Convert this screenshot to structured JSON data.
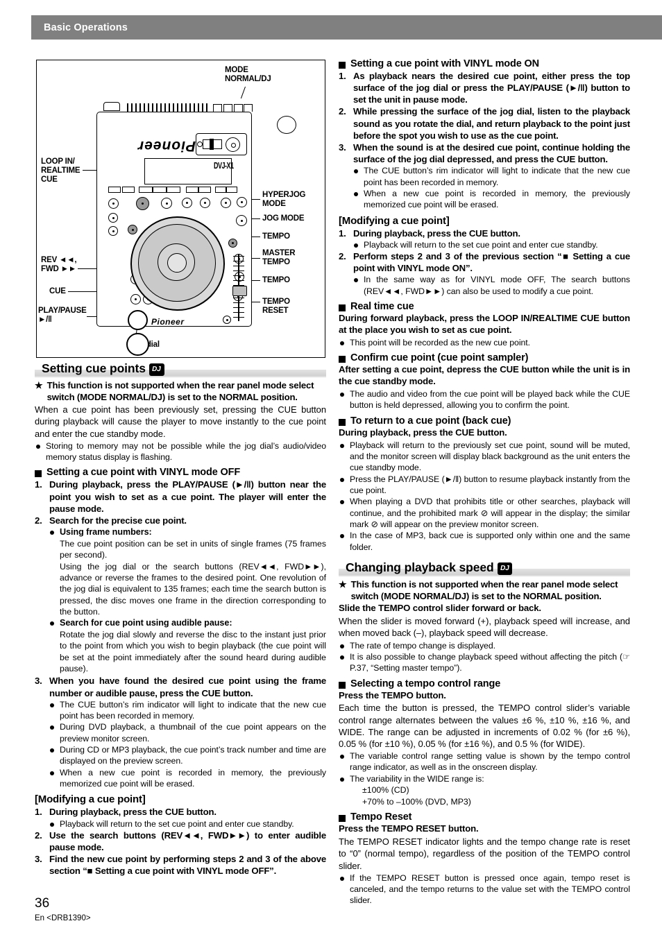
{
  "running_header": {
    "title": "Basic Operations"
  },
  "figure": {
    "caption_jog": "Jog dial",
    "callouts": {
      "mode": "MODE\nNORMAL/DJ",
      "mode_l1": "MODE",
      "mode_l2": "NORMAL/DJ",
      "loop_in_l1": "LOOP IN/",
      "loop_in_l2": "REALTIME",
      "loop_in_l3": "CUE",
      "rev_l1": "REV ◄◄,",
      "rev_l2": "FWD ►►",
      "cue": "CUE",
      "play_l1": "PLAY/PAUSE",
      "play_l2": "►/‖",
      "hyperjog_l1": "HYPERJOG",
      "hyperjog_l2": "MODE",
      "jogmode": "JOG MODE",
      "tempo1": "TEMPO",
      "master_l1": "MASTER",
      "master_l2": "TEMPO",
      "tempo2": "TEMPO",
      "reset_l1": "TEMPO",
      "reset_l2": "RESET"
    },
    "device_brand": "Pioneer",
    "device_model": "DVJ-X1"
  },
  "left_column": {
    "heading": "Setting cue points",
    "heading_badge": "DJ",
    "star_note": "This function is not supported when the rear panel mode select switch (MODE NORMAL/DJ) is set to the NORMAL position.",
    "intro": "When a cue point has been previously set, pressing the CUE button during playback will cause the player to move instantly to the cue point and enter the cue standby mode.",
    "intro_bullet": "Storing to memory may not be possible while the jog dial’s audio/video memory status display is flashing.",
    "vinyl_off": {
      "heading": "Setting a cue point with VINYL mode OFF",
      "step1": "During playback, press the PLAY/PAUSE (►/‖) button near the point you wish to set as a cue point. The player will enter the pause mode.",
      "step2": "Search for the precise cue point.",
      "sub1_title": "Using frame numbers:",
      "sub1_p1": "The cue point position can be set in units of single frames (75 frames per second).",
      "sub1_p2": "Using the jog dial or the search buttons (REV◄◄, FWD►►), advance or reverse the frames to the desired point. One revolution of the jog dial is equivalent to 135 frames; each time the search button is pressed, the disc moves one frame in the direction corresponding to the button.",
      "sub2_title": "Search for cue point using audible pause:",
      "sub2_p1": "Rotate the jog dial slowly and reverse the disc to the instant just prior to the point from which you wish to begin playback (the cue point will be set at the point immediately after the sound heard during audible pause).",
      "step3": "When you have found the desired cue point using the frame number or audible pause, press the CUE button.",
      "step3_bullets": [
        "The CUE button’s rim indicator will light to indicate that the new cue point has been recorded in memory.",
        "During DVD playback, a thumbnail of the cue point appears on the preview monitor screen.",
        "During CD or MP3 playback, the cue point’s track number and time are displayed on the preview screen.",
        "When a new cue point is recorded in memory, the previously memorized cue point will be erased."
      ]
    },
    "modifying": {
      "heading": "[Modifying a cue point]",
      "step1": "During playback, press the CUE button.",
      "step1_bullet": "Playback will return to the set cue point and enter cue standby.",
      "step2": "Use the search buttons (REV◄◄, FWD►►) to enter audible pause mode.",
      "step3": "Find the new cue point by performing steps 2 and 3 of the above section “■ Setting a cue point with VINYL mode OFF”."
    }
  },
  "right_column": {
    "vinyl_on": {
      "heading": "Setting a cue point with VINYL mode ON",
      "step1": "As playback nears the desired cue point, either press the top surface of the jog dial or press the PLAY/PAUSE (►/‖) button to set the unit in pause mode.",
      "step2": "While pressing the surface of the jog dial, listen to the playback sound as you rotate the dial, and return playback to the point just before the spot you wish to use as the cue point.",
      "step3": "When the sound is at the desired cue point, continue holding the surface of the jog dial depressed, and press the CUE button.",
      "step3_bullets": [
        "The CUE button’s rim indicator will light to indicate that the new cue point has been recorded in memory.",
        "When a new cue point is recorded in memory, the previously memorized cue point will be erased."
      ]
    },
    "modifying": {
      "heading": "[Modifying a cue point]",
      "step1": "During playback, press the CUE button.",
      "step1_bullet": "Playback will return to the set cue point and enter cue standby.",
      "step2": "Perform steps 2 and 3 of the previous section “■ Setting a cue point with VINYL mode ON”.",
      "step2_bullet": "In the same way as for VINYL mode OFF, The search buttons (REV◄◄, FWD►►) can also be used to modify a cue point."
    },
    "realtime_cue": {
      "heading": "Real time cue",
      "lead": "During forward playback, press the LOOP IN/REALTIME CUE button at the place you wish to set as cue point.",
      "bullet": "This point will be recorded as the new cue point."
    },
    "confirm_cue": {
      "heading": "Confirm cue point (cue point sampler)",
      "lead": "After setting a cue point, depress the CUE button while the unit is in the cue standby mode.",
      "bullet": "The audio and video from the cue point will be played back while the CUE button is held depressed, allowing you to confirm the point."
    },
    "back_cue": {
      "heading": "To return to a cue point (back cue)",
      "lead": "During playback, press the CUE button.",
      "bullets": [
        "Playback will return to the previously set cue point, sound will be muted, and the monitor screen will display black background as the unit enters the cue standby mode.",
        "Press the PLAY/PAUSE (►/‖) button to resume playback instantly from the cue point.",
        "When playing a DVD that prohibits title or other searches, playback will continue, and the prohibited mark ⊘ will appear in the display; the similar mark ⊘ will appear on the preview monitor screen.",
        "In the case of MP3, back cue is supported only within one and the same folder."
      ]
    },
    "playback_speed": {
      "heading": "Changing playback speed",
      "heading_badge": "DJ",
      "star_note": "This function is not supported when the rear panel mode select switch (MODE NORMAL/DJ) is set to the NORMAL position.",
      "lead": "Slide the TEMPO control slider forward or back.",
      "body": "When the slider is moved forward (+), playback speed will increase, and when moved back (–), playback speed will decrease.",
      "bullets": [
        "The rate of tempo change is displayed.",
        "It is also possible to change playback speed without affecting the pitch (☞ P.37, “Setting master tempo”)."
      ]
    },
    "tempo_range": {
      "heading": "Selecting a tempo control range",
      "lead": "Press the TEMPO button.",
      "body": "Each time the button is pressed, the TEMPO control slider’s variable control range alternates between the values ±6 %, ±10 %, ±16 %, and WIDE. The range can be adjusted in increments of 0.02 % (for ±6 %), 0.05 % (for ±10 %), 0.05 % (for ±16 %), and 0.5 % (for WIDE).",
      "bullets": [
        "The variable control range setting value is shown by the tempo control range indicator, as well as in the onscreen display.",
        "The variability in the WIDE range is:"
      ],
      "wide_line1": "±100% (CD)",
      "wide_line2": "+70% to –100% (DVD, MP3)"
    },
    "tempo_reset": {
      "heading": "Tempo Reset",
      "lead": "Press the TEMPO RESET button.",
      "body": "The TEMPO RESET indicator lights and the tempo change rate is reset to “0” (normal tempo), regardless of the position of the TEMPO control slider.",
      "bullet": "If the TEMPO RESET button is pressed once again, tempo reset is canceled, and the tempo returns to the value set with the TEMPO control slider."
    }
  },
  "footer": {
    "page_number": "36",
    "code": "En <DRB1390>"
  }
}
